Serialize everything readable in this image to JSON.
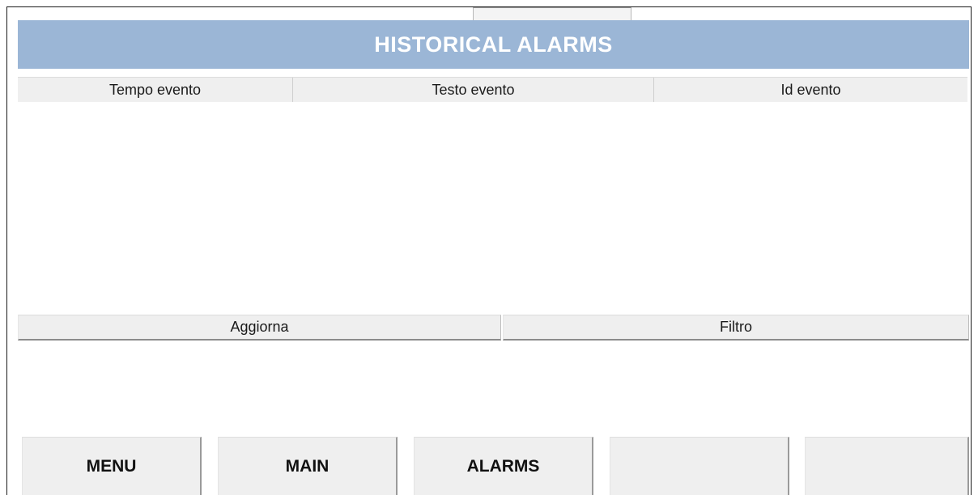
{
  "title": "HISTORICAL ALARMS",
  "alarm_table": {
    "columns": [
      "Tempo evento",
      "Testo evento",
      "Id evento"
    ],
    "rows": []
  },
  "actions": {
    "refresh_label": "Aggiorna",
    "filter_label": "Filtro"
  },
  "nav": {
    "buttons": [
      "MENU",
      "MAIN",
      "ALARMS",
      "",
      ""
    ]
  },
  "colors": {
    "title_bar": "#9bb6d6",
    "title_text": "#ffffff",
    "button_face": "#efefef"
  }
}
